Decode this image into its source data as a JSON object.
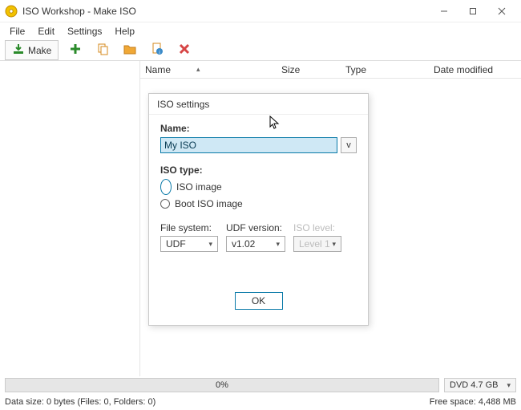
{
  "window": {
    "title": "ISO Workshop - Make ISO"
  },
  "menu": {
    "file": "File",
    "edit": "Edit",
    "settings": "Settings",
    "help": "Help"
  },
  "toolbar": {
    "make": "Make"
  },
  "columns": {
    "name": "Name",
    "size": "Size",
    "type": "Type",
    "date": "Date modified"
  },
  "dialog": {
    "title": "ISO settings",
    "name_label": "Name:",
    "name_value": "My ISO",
    "history_btn": "v",
    "type_label": "ISO type:",
    "type_iso": "ISO image",
    "type_boot": "Boot ISO image",
    "type_selected": "iso",
    "fs_label": "File system:",
    "fs_value": "UDF",
    "udf_label": "UDF version:",
    "udf_value": "v1.02",
    "isolevel_label": "ISO level:",
    "isolevel_value": "Level 1",
    "ok": "OK"
  },
  "bottom": {
    "progress_text": "0%",
    "disc": "DVD 4.7 GB"
  },
  "status": {
    "left": "Data size: 0 bytes (Files: 0, Folders: 0)",
    "right": "Free space: 4,488 MB"
  }
}
